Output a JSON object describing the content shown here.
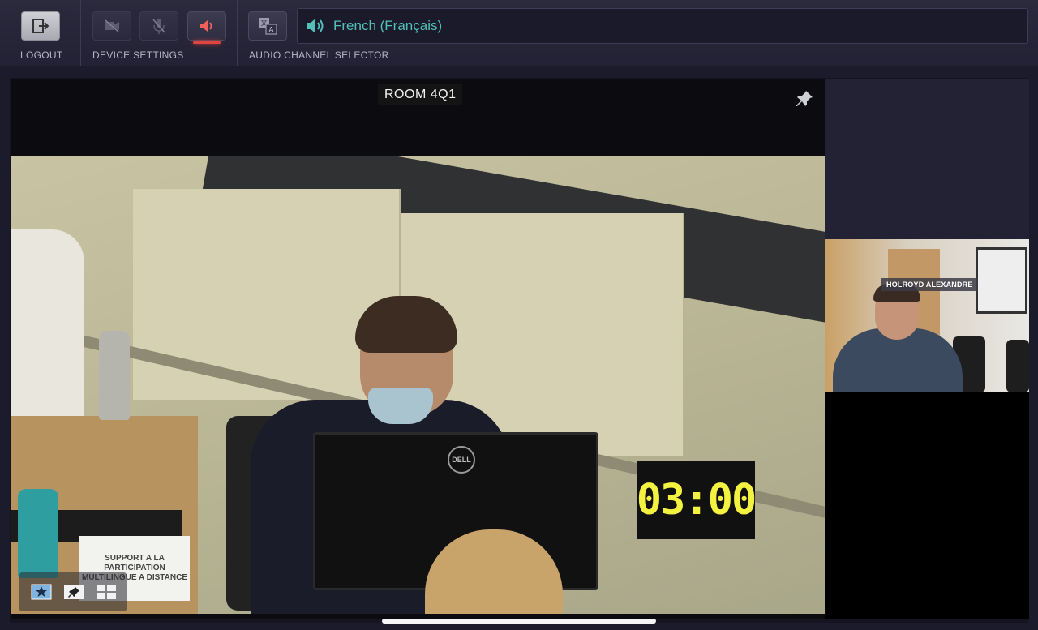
{
  "toolbar": {
    "logout_label": "LOGOUT",
    "device_settings_label": "DEVICE SETTINGS",
    "audio_channel_label": "AUDIO CHANNEL SELECTOR",
    "buttons": {
      "logout": "logout-icon",
      "camera": "camera-off-icon",
      "microphone": "mic-off-icon",
      "speaker": "speaker-icon",
      "translate": "translate-icon"
    }
  },
  "channel": {
    "selected": "French (Français)",
    "icon": "speaker-icon",
    "accent_color": "#53c0b8"
  },
  "main_video": {
    "room_label": "ROOM 4Q1",
    "timer": "03:00",
    "placard_text": "SUPPORT A LA PARTICIPATION MULTILINGUE A DISTANCE",
    "monitor_brand": "DELL"
  },
  "side_panel": {
    "participant_name": "HOLROYD ALEXANDRE"
  },
  "layout_controls": [
    "featured-layout-icon",
    "pinned-layout-icon",
    "grid-layout-icon"
  ],
  "colors": {
    "active_speaker_indicator": "#e0443e",
    "timer_text": "#f4f240"
  }
}
